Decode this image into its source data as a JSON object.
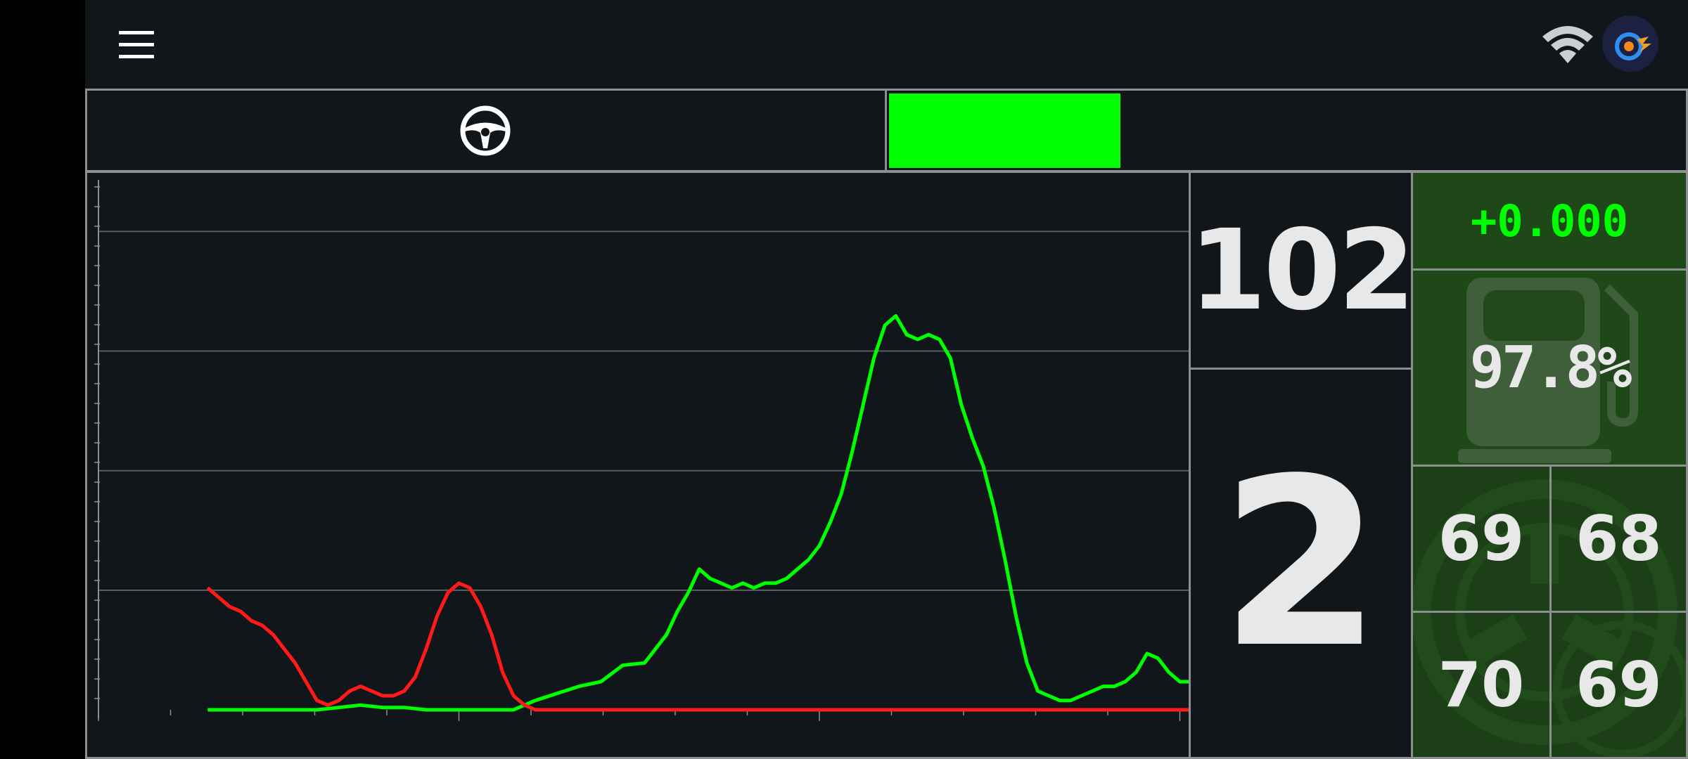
{
  "app": {
    "title": ""
  },
  "icons": {
    "menu": "hamburger-menu-icon",
    "wifi": "wifi-icon",
    "avatar": "app-logo-avatar",
    "steering": "steering-wheel-icon",
    "fuel": "fuel-pump-icon",
    "tyre": "tyre-icon"
  },
  "status": {
    "throttle_bar_fraction": 0.29,
    "throttle_bar_color": "#00ff00"
  },
  "dashboard": {
    "speed": "102",
    "gear": "2",
    "delta": "+0.000",
    "fuel": "97.8%",
    "tyres": {
      "front_left": "69",
      "front_right": "68",
      "rear_left": "70",
      "rear_right": "69"
    }
  },
  "colors": {
    "background": "#11161b",
    "panel_green": "#1e4818",
    "accent_green": "#00ff00",
    "brake_red": "#ff1a1a",
    "border": "#8d8f91"
  },
  "chart_data": {
    "type": "line",
    "title": "",
    "xlabel": "",
    "ylabel": "",
    "ylim": [
      0,
      110
    ],
    "xlim": [
      0,
      100
    ],
    "grid": true,
    "legend": "none",
    "series": [
      {
        "color": "#00ff00",
        "points": [
          [
            10,
            0
          ],
          [
            12,
            0
          ],
          [
            14,
            0
          ],
          [
            16,
            0
          ],
          [
            18,
            0
          ],
          [
            20,
            0
          ],
          [
            22,
            0.5
          ],
          [
            24,
            1
          ],
          [
            26,
            0.5
          ],
          [
            28,
            0.5
          ],
          [
            30,
            0
          ],
          [
            32,
            0
          ],
          [
            34,
            0
          ],
          [
            36,
            0
          ],
          [
            38,
            0
          ],
          [
            40,
            2
          ],
          [
            42,
            3.5
          ],
          [
            44,
            5
          ],
          [
            46,
            6
          ],
          [
            48,
            9.5
          ],
          [
            50,
            10
          ],
          [
            52,
            16
          ],
          [
            53,
            21
          ],
          [
            54,
            25
          ],
          [
            55,
            30
          ],
          [
            56,
            28
          ],
          [
            57,
            27
          ],
          [
            58,
            26
          ],
          [
            59,
            27
          ],
          [
            60,
            26
          ],
          [
            61,
            27
          ],
          [
            62,
            27
          ],
          [
            63,
            28
          ],
          [
            64,
            30
          ],
          [
            65,
            32
          ],
          [
            66,
            35
          ],
          [
            67,
            40
          ],
          [
            68,
            46
          ],
          [
            69,
            55
          ],
          [
            70,
            65
          ],
          [
            71,
            75
          ],
          [
            72,
            82
          ],
          [
            73,
            84
          ],
          [
            74,
            80
          ],
          [
            75,
            79
          ],
          [
            76,
            80
          ],
          [
            77,
            79
          ],
          [
            78,
            75
          ],
          [
            79,
            65
          ],
          [
            80,
            58
          ],
          [
            81,
            52
          ],
          [
            82,
            43
          ],
          [
            83,
            32
          ],
          [
            84,
            20
          ],
          [
            85,
            10
          ],
          [
            86,
            4
          ],
          [
            87,
            3
          ],
          [
            88,
            2
          ],
          [
            89,
            2
          ],
          [
            90,
            3
          ],
          [
            91,
            4
          ],
          [
            92,
            5
          ],
          [
            93,
            5
          ],
          [
            94,
            6
          ],
          [
            95,
            8
          ],
          [
            96,
            12
          ],
          [
            97,
            11
          ],
          [
            98,
            8
          ],
          [
            99,
            6
          ],
          [
            100,
            6
          ],
          [
            101,
            5
          ],
          [
            102,
            4
          ],
          [
            103,
            3
          ],
          [
            104,
            5
          ]
        ]
      },
      {
        "color": "#ff1a1a",
        "points": [
          [
            10,
            26
          ],
          [
            11,
            24
          ],
          [
            12,
            22
          ],
          [
            13,
            21
          ],
          [
            14,
            19
          ],
          [
            15,
            18
          ],
          [
            16,
            16
          ],
          [
            17,
            13
          ],
          [
            18,
            10
          ],
          [
            19,
            6
          ],
          [
            20,
            2
          ],
          [
            21,
            1
          ],
          [
            22,
            2
          ],
          [
            23,
            4
          ],
          [
            24,
            5
          ],
          [
            25,
            4
          ],
          [
            26,
            3
          ],
          [
            27,
            3
          ],
          [
            28,
            4
          ],
          [
            29,
            7
          ],
          [
            30,
            13
          ],
          [
            31,
            20
          ],
          [
            32,
            25
          ],
          [
            33,
            27
          ],
          [
            34,
            26
          ],
          [
            35,
            22
          ],
          [
            36,
            16
          ],
          [
            37,
            8
          ],
          [
            38,
            3
          ],
          [
            39,
            1
          ],
          [
            40,
            0
          ],
          [
            42,
            0
          ],
          [
            50,
            0
          ],
          [
            60,
            0
          ],
          [
            70,
            0
          ],
          [
            80,
            0
          ],
          [
            90,
            0
          ],
          [
            100,
            0
          ],
          [
            104,
            0
          ]
        ]
      }
    ]
  }
}
